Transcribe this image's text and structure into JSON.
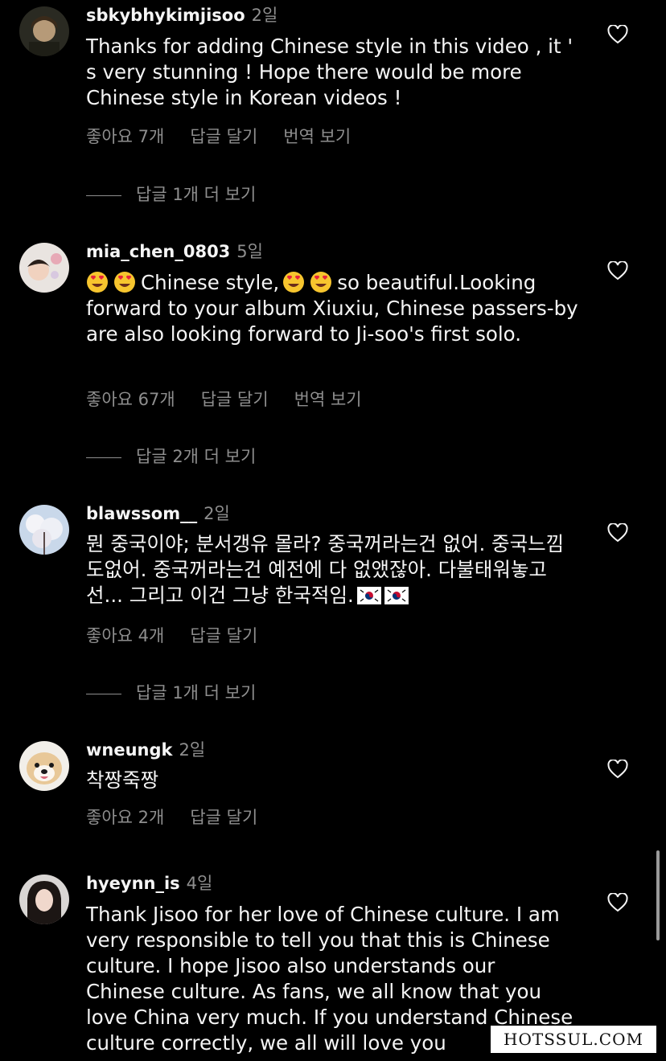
{
  "comments": [
    {
      "username": "sbkybhykimjisoo",
      "time": "2일",
      "text": "Thanks for adding Chinese style in this video , it ' s very stunning ! Hope there would be more Chinese style in Korean videos !",
      "likes": "좋아요 7개",
      "reply": "답글 달기",
      "translate": "번역 보기",
      "more_replies": "답글 1개 더 보기"
    },
    {
      "username": "mia_chen_0803",
      "time": "5일",
      "text": "Chinese style,",
      "text_after": "so beautiful.Looking forward to your album Xiuxiu, Chinese passers-by are also looking forward to Ji-soo's first solo.",
      "likes": "좋아요 67개",
      "reply": "답글 달기",
      "translate": "번역 보기",
      "more_replies": "답글 2개 더 보기",
      "emoji": "heart-eyes-emoji"
    },
    {
      "username": "blawssom__",
      "time": "2일",
      "text": "뭔 중국이야; 분서갱유 몰라? 중국꺼라는건 없어. 중국느낌도없어. 중국꺼라는건 예전에 다 없앴잖아. 다불태워놓고선... 그리고 이건 그냥 한국적임.",
      "likes": "좋아요 4개",
      "reply": "답글 달기",
      "more_replies": "답글 1개 더 보기",
      "emoji": "korea-flag-emoji"
    },
    {
      "username": "wneungk",
      "time": "2일",
      "text": "착짱죽짱",
      "likes": "좋아요 2개",
      "reply": "답글 달기"
    },
    {
      "username": "hyeynn_is",
      "time": "4일",
      "text": "Thank Jisoo for her love of Chinese culture. I am very responsible to tell you that this is Chinese culture. I hope Jisoo also understands our Chinese culture. As fans, we all know that you love China very much. If you understand Chinese culture correctly, we all will love you"
    }
  ],
  "watermark": "HOTSSUL.COM",
  "icons": {
    "heart": "heart-outline-icon"
  },
  "colors": {
    "background": "#000000",
    "primary_text": "#f5f5f5",
    "secondary_text": "#8e8e8e"
  }
}
